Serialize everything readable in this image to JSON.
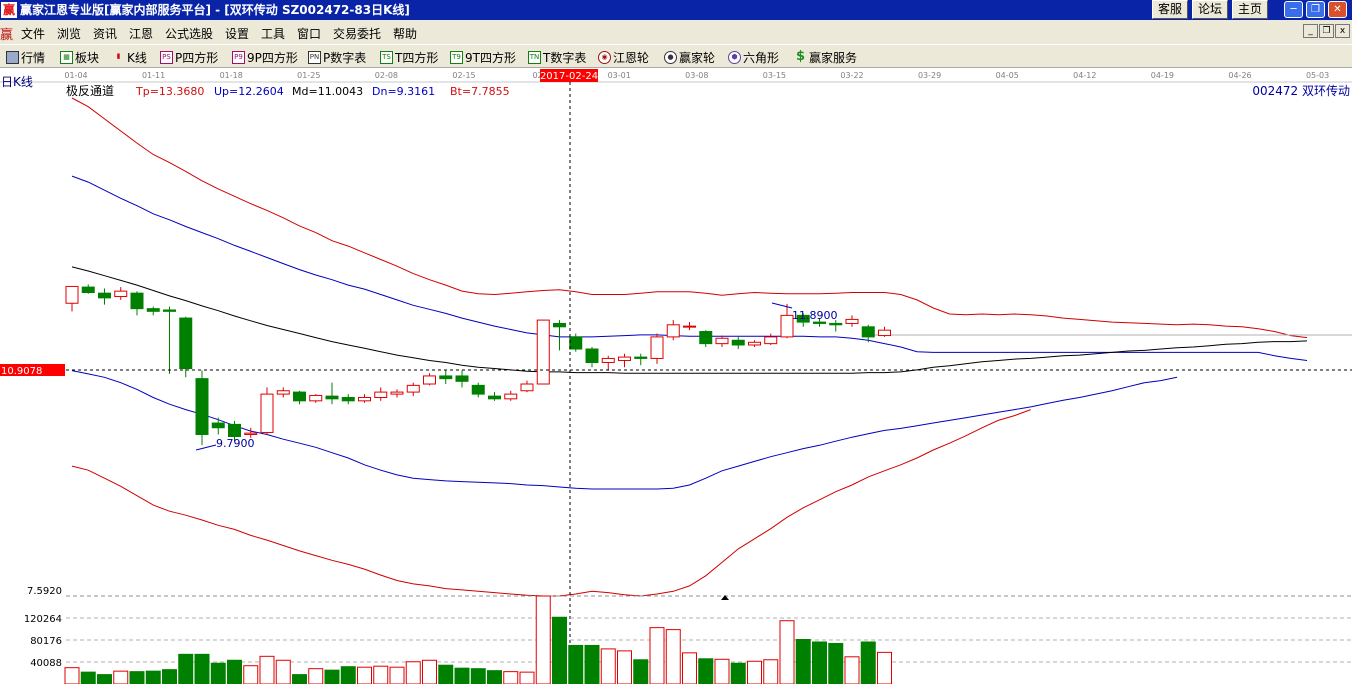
{
  "titlebar": {
    "title": "赢家江恩专业版[赢家内部服务平台] - [双环传动  SZ002472-83日K线]",
    "links": [
      "客服",
      "论坛",
      "主页"
    ]
  },
  "menubar": {
    "items": [
      "文件",
      "浏览",
      "资讯",
      "江恩",
      "公式选股",
      "设置",
      "工具",
      "窗口",
      "交易委托",
      "帮助"
    ]
  },
  "toolbar": {
    "items": [
      {
        "icon": "grid-icon",
        "badge": "",
        "label": "行情"
      },
      {
        "icon": "sector-icon",
        "badge": "",
        "label": "板块"
      },
      {
        "icon": "candlestick-icon",
        "badge": "",
        "label": "K线"
      },
      {
        "icon": "ps-icon",
        "badge": "PS",
        "label": "P四方形"
      },
      {
        "icon": "p9-icon",
        "badge": "P9",
        "label": "9P四方形"
      },
      {
        "icon": "pn-icon",
        "badge": "PN",
        "label": "P数字表"
      },
      {
        "icon": "ts-icon",
        "badge": "TS",
        "label": "T四方形"
      },
      {
        "icon": "t9-icon",
        "badge": "T9",
        "label": "9T四方形"
      },
      {
        "icon": "tn-icon",
        "badge": "TN",
        "label": "T数字表"
      },
      {
        "icon": "gann-wheel-icon",
        "badge": "",
        "label": "江恩轮"
      },
      {
        "icon": "winner-wheel-icon",
        "badge": "",
        "label": "赢家轮"
      },
      {
        "icon": "hexagon-icon",
        "badge": "",
        "label": "六角形"
      },
      {
        "icon": "dollar-icon",
        "badge": "$",
        "label": "赢家服务"
      }
    ]
  },
  "chart_data": {
    "type": "candlestick",
    "period_label": "日K线",
    "indicator": {
      "name": "极反通道",
      "Tp": "Tp=13.3680",
      "Up": "Up=12.2604",
      "Md": "Md=11.0043",
      "Dn": "Dn=9.3161",
      "Bt": "Bt=7.7855"
    },
    "stock": "002472  双环传动",
    "date_ticks": [
      "01-04",
      "01-11",
      "01-18",
      "01-25",
      "02-08",
      "02-15",
      "02-2",
      "03-01",
      "03-08",
      "03-15",
      "03-22",
      "03-29",
      "04-05",
      "04-12",
      "04-19",
      "04-26",
      "05-03"
    ],
    "cursor_date": "2017-02-24",
    "cursor_price": "10.9078",
    "annotations": {
      "high": "11.8900",
      "low": "9.7900"
    },
    "price_axis_label": "7.5920",
    "volume_axis": [
      "120264",
      "80176",
      "40088"
    ],
    "price_range": [
      7.55,
      14.95
    ],
    "volume_max": 178000,
    "candles": [
      {
        "o": 11.9,
        "h": 12.12,
        "c": 12.15,
        "l": 11.78,
        "v": 33000
      },
      {
        "o": 12.14,
        "h": 12.18,
        "c": 12.06,
        "l": 12.04,
        "v": 24000
      },
      {
        "o": 12.05,
        "h": 12.12,
        "c": 11.98,
        "l": 11.88,
        "v": 19000
      },
      {
        "o": 12.0,
        "h": 12.14,
        "c": 12.08,
        "l": 11.95,
        "v": 26000
      },
      {
        "o": 12.05,
        "h": 12.08,
        "c": 11.82,
        "l": 11.72,
        "v": 25000
      },
      {
        "o": 11.82,
        "h": 11.85,
        "c": 11.78,
        "l": 11.72,
        "v": 26000
      },
      {
        "o": 11.8,
        "h": 11.85,
        "c": 11.78,
        "l": 10.85,
        "v": 29000
      },
      {
        "o": 11.68,
        "h": 11.7,
        "c": 10.93,
        "l": 10.8,
        "v": 60000
      },
      {
        "o": 10.78,
        "h": 10.9,
        "c": 9.95,
        "l": 9.79,
        "v": 60000
      },
      {
        "o": 10.12,
        "h": 10.2,
        "c": 10.05,
        "l": 9.95,
        "v": 42000
      },
      {
        "o": 10.1,
        "h": 10.15,
        "c": 9.92,
        "l": 9.85,
        "v": 48000
      },
      {
        "o": 9.95,
        "h": 10.05,
        "c": 9.97,
        "l": 9.9,
        "v": 37000
      },
      {
        "o": 9.98,
        "h": 10.65,
        "c": 10.55,
        "l": 9.95,
        "v": 56000
      },
      {
        "o": 10.55,
        "h": 10.65,
        "c": 10.6,
        "l": 10.5,
        "v": 48000
      },
      {
        "o": 10.58,
        "h": 10.6,
        "c": 10.45,
        "l": 10.4,
        "v": 19000
      },
      {
        "o": 10.45,
        "h": 10.55,
        "c": 10.53,
        "l": 10.42,
        "v": 31000
      },
      {
        "o": 10.52,
        "h": 10.72,
        "c": 10.48,
        "l": 10.4,
        "v": 28000
      },
      {
        "o": 10.5,
        "h": 10.55,
        "c": 10.45,
        "l": 10.4,
        "v": 35000
      },
      {
        "o": 10.45,
        "h": 10.55,
        "c": 10.5,
        "l": 10.42,
        "v": 34000
      },
      {
        "o": 10.5,
        "h": 10.65,
        "c": 10.58,
        "l": 10.45,
        "v": 36000
      },
      {
        "o": 10.55,
        "h": 10.62,
        "c": 10.58,
        "l": 10.5,
        "v": 34000
      },
      {
        "o": 10.58,
        "h": 10.72,
        "c": 10.68,
        "l": 10.52,
        "v": 45000
      },
      {
        "o": 10.7,
        "h": 10.86,
        "c": 10.82,
        "l": 10.68,
        "v": 48000
      },
      {
        "o": 10.82,
        "h": 10.9,
        "c": 10.78,
        "l": 10.7,
        "v": 38000
      },
      {
        "o": 10.82,
        "h": 10.9,
        "c": 10.74,
        "l": 10.65,
        "v": 32000
      },
      {
        "o": 10.68,
        "h": 10.72,
        "c": 10.55,
        "l": 10.5,
        "v": 31000
      },
      {
        "o": 10.52,
        "h": 10.58,
        "c": 10.48,
        "l": 10.45,
        "v": 27000
      },
      {
        "o": 10.48,
        "h": 10.6,
        "c": 10.55,
        "l": 10.45,
        "v": 25000
      },
      {
        "o": 10.6,
        "h": 10.75,
        "c": 10.7,
        "l": 10.58,
        "v": 24000
      },
      {
        "o": 10.7,
        "h": 11.65,
        "c": 11.65,
        "l": 10.7,
        "v": 178000
      },
      {
        "o": 11.6,
        "h": 11.65,
        "c": 11.55,
        "l": 11.2,
        "v": 135000
      },
      {
        "o": 11.4,
        "h": 11.45,
        "c": 11.22,
        "l": 11.18,
        "v": 78000
      },
      {
        "o": 11.22,
        "h": 11.25,
        "c": 11.02,
        "l": 10.95,
        "v": 78000
      },
      {
        "o": 11.02,
        "h": 11.12,
        "c": 11.08,
        "l": 10.9,
        "v": 71000
      },
      {
        "o": 11.05,
        "h": 11.15,
        "c": 11.1,
        "l": 10.95,
        "v": 67000
      },
      {
        "o": 11.1,
        "h": 11.15,
        "c": 11.08,
        "l": 10.98,
        "v": 49000
      },
      {
        "o": 11.08,
        "h": 11.45,
        "c": 11.4,
        "l": 11.0,
        "v": 114000
      },
      {
        "o": 11.4,
        "h": 11.65,
        "c": 11.58,
        "l": 11.35,
        "v": 110000
      },
      {
        "o": 11.55,
        "h": 11.62,
        "c": 11.56,
        "l": 11.5,
        "v": 63000
      },
      {
        "o": 11.48,
        "h": 11.5,
        "c": 11.3,
        "l": 11.25,
        "v": 51000
      },
      {
        "o": 11.3,
        "h": 11.42,
        "c": 11.38,
        "l": 11.25,
        "v": 50000
      },
      {
        "o": 11.35,
        "h": 11.4,
        "c": 11.28,
        "l": 11.22,
        "v": 42000
      },
      {
        "o": 11.28,
        "h": 11.35,
        "c": 11.32,
        "l": 11.25,
        "v": 46000
      },
      {
        "o": 11.3,
        "h": 11.45,
        "c": 11.4,
        "l": 11.28,
        "v": 49000
      },
      {
        "o": 11.4,
        "h": 11.89,
        "c": 11.72,
        "l": 11.38,
        "v": 128000
      },
      {
        "o": 11.72,
        "h": 11.75,
        "c": 11.62,
        "l": 11.55,
        "v": 90000
      },
      {
        "o": 11.62,
        "h": 11.68,
        "c": 11.6,
        "l": 11.55,
        "v": 85000
      },
      {
        "o": 11.6,
        "h": 11.65,
        "c": 11.58,
        "l": 11.48,
        "v": 82000
      },
      {
        "o": 11.6,
        "h": 11.72,
        "c": 11.66,
        "l": 11.55,
        "v": 55000
      },
      {
        "o": 11.55,
        "h": 11.58,
        "c": 11.4,
        "l": 11.32,
        "v": 85000
      },
      {
        "o": 11.42,
        "h": 11.55,
        "c": 11.5,
        "l": 11.4,
        "v": 64000
      }
    ],
    "channel_lines": {
      "tp": [
        14.95,
        14.82,
        14.64,
        14.46,
        14.28,
        14.11,
        13.99,
        13.86,
        13.72,
        13.6,
        13.49,
        13.38,
        13.28,
        13.17,
        13.05,
        12.95,
        12.83,
        12.75,
        12.65,
        12.55,
        12.45,
        12.34,
        12.25,
        12.17,
        12.08,
        12.04,
        12.03,
        12.05,
        12.07,
        12.09,
        12.1,
        12.07,
        12.03,
        12.03,
        12.03,
        12.05,
        12.07,
        12.07,
        12.07,
        12.05,
        12.02,
        12.04,
        12.06,
        12.05,
        12.04,
        12.04,
        12.04,
        12.05,
        12.06,
        12.06,
        12.06,
        12.03,
        11.95,
        11.83,
        11.74,
        11.73,
        11.74,
        11.73,
        11.74,
        11.73,
        11.71,
        11.68,
        11.66,
        11.64,
        11.62,
        11.61,
        11.6,
        11.59,
        11.58,
        11.59,
        11.58,
        11.56,
        11.55,
        11.52,
        11.48,
        11.42,
        11.39
      ],
      "up": [
        13.79,
        13.7,
        13.58,
        13.46,
        13.35,
        13.23,
        13.14,
        13.04,
        12.95,
        12.86,
        12.76,
        12.67,
        12.58,
        12.49,
        12.4,
        12.32,
        12.25,
        12.17,
        12.11,
        12.03,
        11.95,
        11.87,
        11.81,
        11.75,
        11.68,
        11.62,
        11.56,
        11.51,
        11.46,
        11.43,
        11.4,
        11.4,
        11.4,
        11.41,
        11.42,
        11.43,
        11.43,
        11.42,
        11.41,
        11.41,
        11.41,
        11.41,
        11.41,
        11.41,
        11.41,
        11.41,
        11.4,
        11.4,
        11.38,
        11.35,
        11.3,
        11.25,
        11.18,
        11.17,
        11.17,
        11.17,
        11.17,
        11.17,
        11.17,
        11.17,
        11.17,
        11.17,
        11.17,
        11.17,
        11.17,
        11.17,
        11.17,
        11.17,
        11.17,
        11.17,
        11.17,
        11.17,
        11.17,
        11.17,
        11.12,
        11.08,
        11.05
      ],
      "md": [
        12.44,
        12.38,
        12.31,
        12.24,
        12.17,
        12.09,
        12.01,
        11.94,
        11.86,
        11.79,
        11.71,
        11.64,
        11.57,
        11.51,
        11.45,
        11.39,
        11.33,
        11.28,
        11.23,
        11.18,
        11.13,
        11.09,
        11.05,
        11.02,
        10.98,
        10.95,
        10.93,
        10.91,
        10.89,
        10.88,
        10.88,
        10.87,
        10.87,
        10.87,
        10.86,
        10.86,
        10.86,
        10.86,
        10.86,
        10.86,
        10.86,
        10.86,
        10.86,
        10.86,
        10.86,
        10.86,
        10.86,
        10.86,
        10.86,
        10.87,
        10.87,
        10.88,
        10.91,
        10.95,
        10.97,
        11.0,
        11.03,
        11.05,
        11.07,
        11.08,
        11.1,
        11.12,
        11.13,
        11.15,
        11.17,
        11.19,
        11.2,
        11.22,
        11.24,
        11.25,
        11.27,
        11.29,
        11.3,
        11.32,
        11.33,
        11.33,
        11.34
      ],
      "dn": [
        10.9,
        10.85,
        10.8,
        10.72,
        10.62,
        10.5,
        10.4,
        10.32,
        10.25,
        10.17,
        10.08,
        10.0,
        9.95,
        9.88,
        9.82,
        9.76,
        9.68,
        9.6,
        9.5,
        9.42,
        9.35,
        9.3,
        9.28,
        9.26,
        9.25,
        9.24,
        9.23,
        9.22,
        9.2,
        9.19,
        9.17,
        9.15,
        9.14,
        9.14,
        9.14,
        9.14,
        9.14,
        9.15,
        9.2,
        9.3,
        9.41,
        9.48,
        9.55,
        9.62,
        9.68,
        9.74,
        9.79,
        9.85,
        9.91,
        9.96,
        10.01,
        10.04,
        10.08,
        10.12,
        10.16,
        10.2,
        10.24,
        10.28,
        10.32,
        10.36,
        10.41,
        10.46,
        10.5,
        10.55,
        10.6,
        10.66,
        10.72,
        10.75,
        10.8
      ],
      "bt": [
        9.48,
        9.42,
        9.3,
        9.18,
        9.04,
        8.9,
        8.81,
        8.75,
        8.68,
        8.6,
        8.54,
        8.45,
        8.38,
        8.3,
        8.22,
        8.15,
        8.08,
        8.02,
        7.95,
        7.86,
        7.78,
        7.73,
        7.7,
        7.66,
        7.64,
        7.62,
        7.6,
        7.58,
        7.56,
        7.55,
        7.55,
        7.58,
        7.62,
        7.6,
        7.57,
        7.55,
        7.58,
        7.62,
        7.7,
        7.85,
        8.05,
        8.25,
        8.4,
        8.55,
        8.72,
        8.86,
        8.98,
        9.1,
        9.2,
        9.32,
        9.41,
        9.5,
        9.6,
        9.72,
        9.82,
        9.93,
        10.05,
        10.16,
        10.23,
        10.32
      ]
    }
  }
}
